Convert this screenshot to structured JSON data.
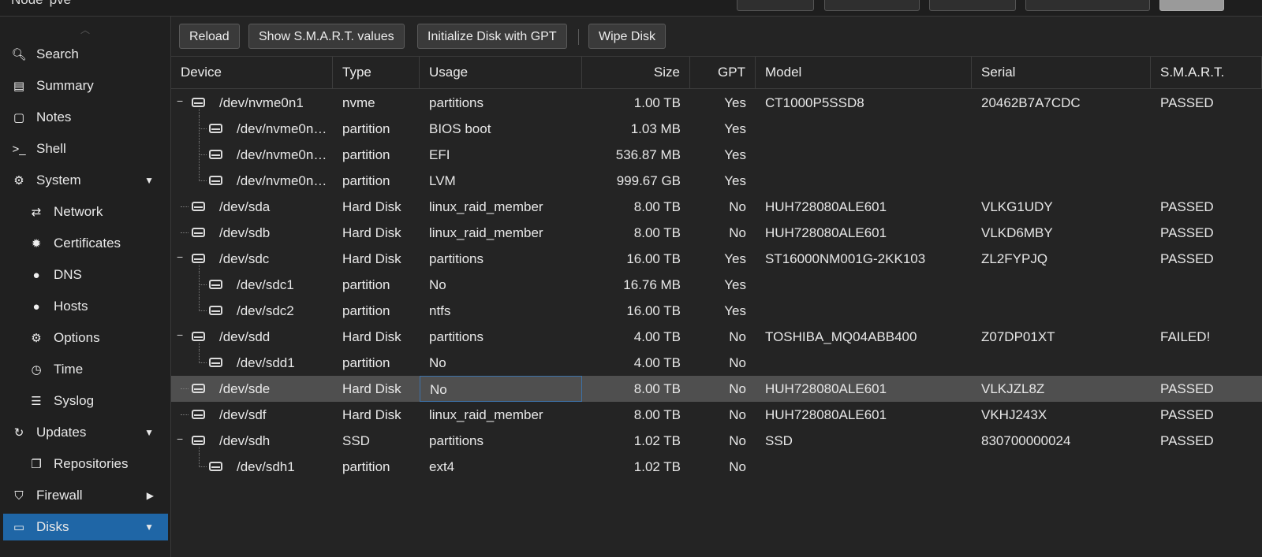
{
  "header": {
    "node_title": "Node 'pve'"
  },
  "sidebar": {
    "items": [
      {
        "label": "Search",
        "icon": "search-icon",
        "glyph": "🔍︎",
        "sub": false,
        "caret": "",
        "active": false
      },
      {
        "label": "Summary",
        "icon": "book-icon",
        "glyph": "▤",
        "sub": false,
        "caret": "",
        "active": false
      },
      {
        "label": "Notes",
        "icon": "sticky-note-icon",
        "glyph": "▢",
        "sub": false,
        "caret": "",
        "active": false
      },
      {
        "label": "Shell",
        "icon": "terminal-icon",
        "glyph": ">_",
        "sub": false,
        "caret": "",
        "active": false
      },
      {
        "label": "System",
        "icon": "cogs-icon",
        "glyph": "⚙",
        "sub": false,
        "caret": "▼",
        "active": false
      },
      {
        "label": "Network",
        "icon": "exchange-icon",
        "glyph": "⇄",
        "sub": true,
        "caret": "",
        "active": false
      },
      {
        "label": "Certificates",
        "icon": "certificate-icon",
        "glyph": "✹",
        "sub": true,
        "caret": "",
        "active": false
      },
      {
        "label": "DNS",
        "icon": "globe-icon",
        "glyph": "●",
        "sub": true,
        "caret": "",
        "active": false
      },
      {
        "label": "Hosts",
        "icon": "globe-icon",
        "glyph": "●",
        "sub": true,
        "caret": "",
        "active": false
      },
      {
        "label": "Options",
        "icon": "gear-icon",
        "glyph": "⚙",
        "sub": true,
        "caret": "",
        "active": false
      },
      {
        "label": "Time",
        "icon": "clock-icon",
        "glyph": "◷",
        "sub": true,
        "caret": "",
        "active": false
      },
      {
        "label": "Syslog",
        "icon": "list-icon",
        "glyph": "☰",
        "sub": true,
        "caret": "",
        "active": false
      },
      {
        "label": "Updates",
        "icon": "refresh-icon",
        "glyph": "↻",
        "sub": false,
        "caret": "▼",
        "active": false
      },
      {
        "label": "Repositories",
        "icon": "files-icon",
        "glyph": "❐",
        "sub": true,
        "caret": "",
        "active": false
      },
      {
        "label": "Firewall",
        "icon": "shield-icon",
        "glyph": "⛉",
        "sub": false,
        "caret": "▶",
        "active": false
      },
      {
        "label": "Disks",
        "icon": "hdd-icon",
        "glyph": "▭",
        "sub": false,
        "caret": "▼",
        "active": true
      }
    ]
  },
  "toolbar": {
    "reload": "Reload",
    "smart": "Show S.M.A.R.T. values",
    "init_gpt": "Initialize Disk with GPT",
    "wipe": "Wipe Disk"
  },
  "grid": {
    "columns": [
      "Device",
      "Type",
      "Usage",
      "Size",
      "GPT",
      "Model",
      "Serial",
      "S.M.A.R.T."
    ],
    "rows": [
      {
        "device": "/dev/nvme0n1",
        "type": "nvme",
        "usage": "partitions",
        "size": "1.00 TB",
        "gpt": "Yes",
        "model": "CT1000P5SSD8",
        "serial": "20462B7A7CDC",
        "smart": "PASSED",
        "level": 0,
        "parent": true,
        "last": false,
        "selected": false
      },
      {
        "device": "/dev/nvme0n…",
        "type": "partition",
        "usage": "BIOS boot",
        "size": "1.03 MB",
        "gpt": "Yes",
        "model": "",
        "serial": "",
        "smart": "",
        "level": 1,
        "parent": false,
        "last": false,
        "selected": false
      },
      {
        "device": "/dev/nvme0n…",
        "type": "partition",
        "usage": "EFI",
        "size": "536.87 MB",
        "gpt": "Yes",
        "model": "",
        "serial": "",
        "smart": "",
        "level": 1,
        "parent": false,
        "last": false,
        "selected": false
      },
      {
        "device": "/dev/nvme0n…",
        "type": "partition",
        "usage": "LVM",
        "size": "999.67 GB",
        "gpt": "Yes",
        "model": "",
        "serial": "",
        "smart": "",
        "level": 1,
        "parent": false,
        "last": true,
        "selected": false
      },
      {
        "device": "/dev/sda",
        "type": "Hard Disk",
        "usage": "linux_raid_member",
        "size": "8.00 TB",
        "gpt": "No",
        "model": "HUH728080ALE601",
        "serial": "VLKG1UDY",
        "smart": "PASSED",
        "level": 0,
        "parent": false,
        "last": false,
        "selected": false
      },
      {
        "device": "/dev/sdb",
        "type": "Hard Disk",
        "usage": "linux_raid_member",
        "size": "8.00 TB",
        "gpt": "No",
        "model": "HUH728080ALE601",
        "serial": "VLKD6MBY",
        "smart": "PASSED",
        "level": 0,
        "parent": false,
        "last": false,
        "selected": false
      },
      {
        "device": "/dev/sdc",
        "type": "Hard Disk",
        "usage": "partitions",
        "size": "16.00 TB",
        "gpt": "Yes",
        "model": "ST16000NM001G-2KK103",
        "serial": "ZL2FYPJQ",
        "smart": "PASSED",
        "level": 0,
        "parent": true,
        "last": false,
        "selected": false
      },
      {
        "device": "/dev/sdc1",
        "type": "partition",
        "usage": "No",
        "size": "16.76 MB",
        "gpt": "Yes",
        "model": "",
        "serial": "",
        "smart": "",
        "level": 1,
        "parent": false,
        "last": false,
        "selected": false
      },
      {
        "device": "/dev/sdc2",
        "type": "partition",
        "usage": "ntfs",
        "size": "16.00 TB",
        "gpt": "Yes",
        "model": "",
        "serial": "",
        "smart": "",
        "level": 1,
        "parent": false,
        "last": true,
        "selected": false
      },
      {
        "device": "/dev/sdd",
        "type": "Hard Disk",
        "usage": "partitions",
        "size": "4.00 TB",
        "gpt": "No",
        "model": "TOSHIBA_MQ04ABB400",
        "serial": "Z07DP01XT",
        "smart": "FAILED!",
        "level": 0,
        "parent": true,
        "last": false,
        "selected": false
      },
      {
        "device": "/dev/sdd1",
        "type": "partition",
        "usage": "No",
        "size": "4.00 TB",
        "gpt": "No",
        "model": "",
        "serial": "",
        "smart": "",
        "level": 1,
        "parent": false,
        "last": true,
        "selected": false
      },
      {
        "device": "/dev/sde",
        "type": "Hard Disk",
        "usage": "No",
        "size": "8.00 TB",
        "gpt": "No",
        "model": "HUH728080ALE601",
        "serial": "VLKJZL8Z",
        "smart": "PASSED",
        "level": 0,
        "parent": false,
        "last": false,
        "selected": true
      },
      {
        "device": "/dev/sdf",
        "type": "Hard Disk",
        "usage": "linux_raid_member",
        "size": "8.00 TB",
        "gpt": "No",
        "model": "HUH728080ALE601",
        "serial": "VKHJ243X",
        "smart": "PASSED",
        "level": 0,
        "parent": false,
        "last": false,
        "selected": false
      },
      {
        "device": "/dev/sdh",
        "type": "SSD",
        "usage": "partitions",
        "size": "1.02 TB",
        "gpt": "No",
        "model": "SSD",
        "serial": "830700000024",
        "smart": "PASSED",
        "level": 0,
        "parent": true,
        "last": false,
        "selected": false
      },
      {
        "device": "/dev/sdh1",
        "type": "partition",
        "usage": "ext4",
        "size": "1.02 TB",
        "gpt": "No",
        "model": "",
        "serial": "",
        "smart": "",
        "level": 1,
        "parent": false,
        "last": true,
        "selected": false
      }
    ]
  },
  "colors": {
    "accent": "#1f66a6",
    "selected_row": "#4f4f4f",
    "background": "#242424"
  }
}
